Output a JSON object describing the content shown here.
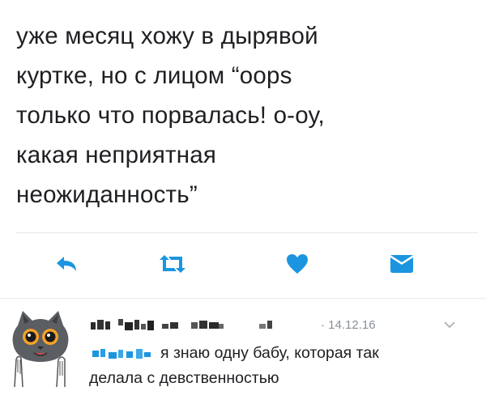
{
  "tweet": {
    "lines": [
      "уже месяц хожу в дырявой",
      "куртке, но с лицом “oops",
      "только что порвалась! о-оу,",
      "какая неприятная",
      "неожиданность”"
    ]
  },
  "actions": {
    "icons": [
      "reply-icon",
      "retweet-icon",
      "like-icon",
      "direct-message-icon"
    ],
    "color": "#1b95e0"
  },
  "reply": {
    "date": "· 14.12.16",
    "text_line1": "я знаю одну бабу, которая так",
    "text_line2": "делала с девственностью"
  }
}
